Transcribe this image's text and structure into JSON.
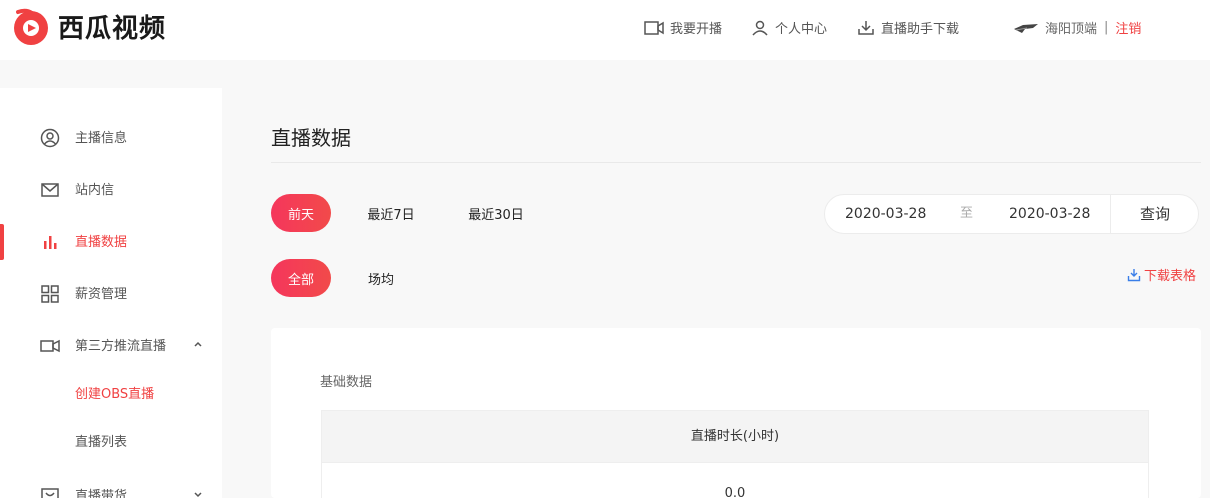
{
  "brand": {
    "name": "西瓜视频",
    "accent": "#f04142"
  },
  "header": {
    "nav": [
      {
        "label": "我要开播",
        "icon": "camera-icon"
      },
      {
        "label": "个人中心",
        "icon": "user-icon"
      },
      {
        "label": "直播助手下载",
        "icon": "download-icon"
      }
    ],
    "user": {
      "name": "海阳顶端",
      "separator": "|",
      "logout": "注销"
    }
  },
  "sidebar": {
    "items": [
      {
        "label": "主播信息",
        "icon": "user-circle-icon"
      },
      {
        "label": "站内信",
        "icon": "mail-icon"
      },
      {
        "label": "直播数据",
        "icon": "bar-chart-icon",
        "active": true
      },
      {
        "label": "薪资管理",
        "icon": "grid-icon"
      },
      {
        "label": "第三方推流直播",
        "icon": "video-icon",
        "expanded": true,
        "children": [
          {
            "label": "创建OBS直播",
            "active": true
          },
          {
            "label": "直播列表"
          }
        ]
      },
      {
        "label": "直播带货",
        "icon": "shop-icon",
        "expanded": false
      }
    ]
  },
  "main": {
    "title": "直播数据",
    "range_tabs": [
      {
        "label": "前天",
        "active": true
      },
      {
        "label": "最近7日"
      },
      {
        "label": "最近30日"
      }
    ],
    "scope_tabs": [
      {
        "label": "全部",
        "active": true
      },
      {
        "label": "场均"
      }
    ],
    "date_range": {
      "start": "2020-03-28",
      "separator": "至",
      "end": "2020-03-28",
      "query": "查询"
    },
    "download": "下载表格",
    "card": {
      "title": "基础数据",
      "table": {
        "header": "直播时长(小时)",
        "value": "0.0"
      }
    }
  }
}
